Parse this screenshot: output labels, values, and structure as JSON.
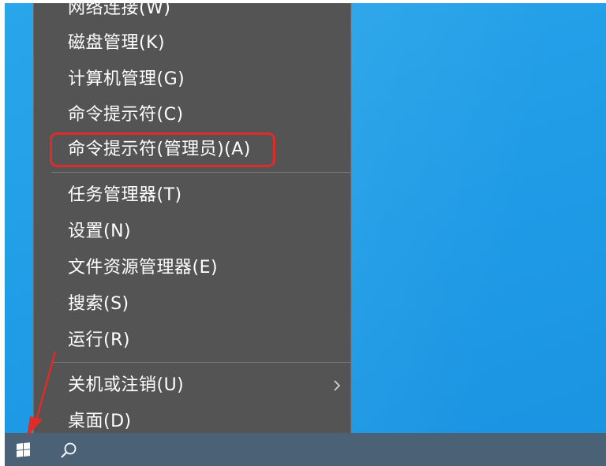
{
  "context_menu": {
    "items": [
      {
        "label": "网络连接(W)"
      },
      {
        "label": "磁盘管理(K)"
      },
      {
        "label": "计算机管理(G)"
      },
      {
        "label": "命令提示符(C)"
      },
      {
        "label": "命令提示符(管理员)(A)"
      },
      {
        "label": "任务管理器(T)"
      },
      {
        "label": "设置(N)"
      },
      {
        "label": "文件资源管理器(E)"
      },
      {
        "label": "搜索(S)"
      },
      {
        "label": "运行(R)"
      },
      {
        "label": "关机或注销(U)"
      },
      {
        "label": "桌面(D)"
      }
    ]
  },
  "taskbar": {
    "start_icon": "windows-logo-icon",
    "search_icon": "search-icon"
  },
  "annotation": {
    "highlight_color": "#e02b2b",
    "highlighted_item": "命令提示符(管理员)(A)"
  },
  "colors": {
    "menu_background": "#545454",
    "desktop": "#1f9be6",
    "taskbar": "#4b6276"
  }
}
